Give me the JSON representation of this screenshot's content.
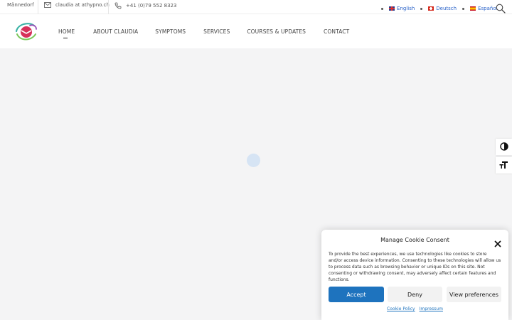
{
  "topbar": {
    "location": "Männedorf",
    "email": "claudia at athypno.ch",
    "phone": "+41 (0)79 552 8323",
    "languages": [
      {
        "label": "English",
        "flag": "flag-uk-icon"
      },
      {
        "label": "Deutsch",
        "flag": "flag-ch-icon"
      },
      {
        "label": "Español",
        "flag": "flag-es-icon"
      }
    ]
  },
  "nav": {
    "items": [
      "HOME",
      "ABOUT CLAUDIA",
      "SYMPTOMS",
      "SERVICES",
      "COURSES & UPDATES",
      "CONTACT"
    ],
    "active": "HOME"
  },
  "cookie": {
    "title": "Manage Cookie Consent",
    "text": "To provide the best experiences, we use technologies like cookies to store and/or access device information. Consenting to these technologies will allow us to process data such as browsing behavior or unique IDs on this site. Not consenting or withdrawing consent, may adversely affect certain features and functions.",
    "accept": "Accept",
    "deny": "Deny",
    "preferences": "View preferences",
    "links": [
      "Cookie Policy",
      "Impressum"
    ]
  },
  "colors": {
    "accent": "#1e73be",
    "link": "#2b63c9",
    "loader": "#d6e4f4",
    "page_bg": "#f4f4f5"
  }
}
